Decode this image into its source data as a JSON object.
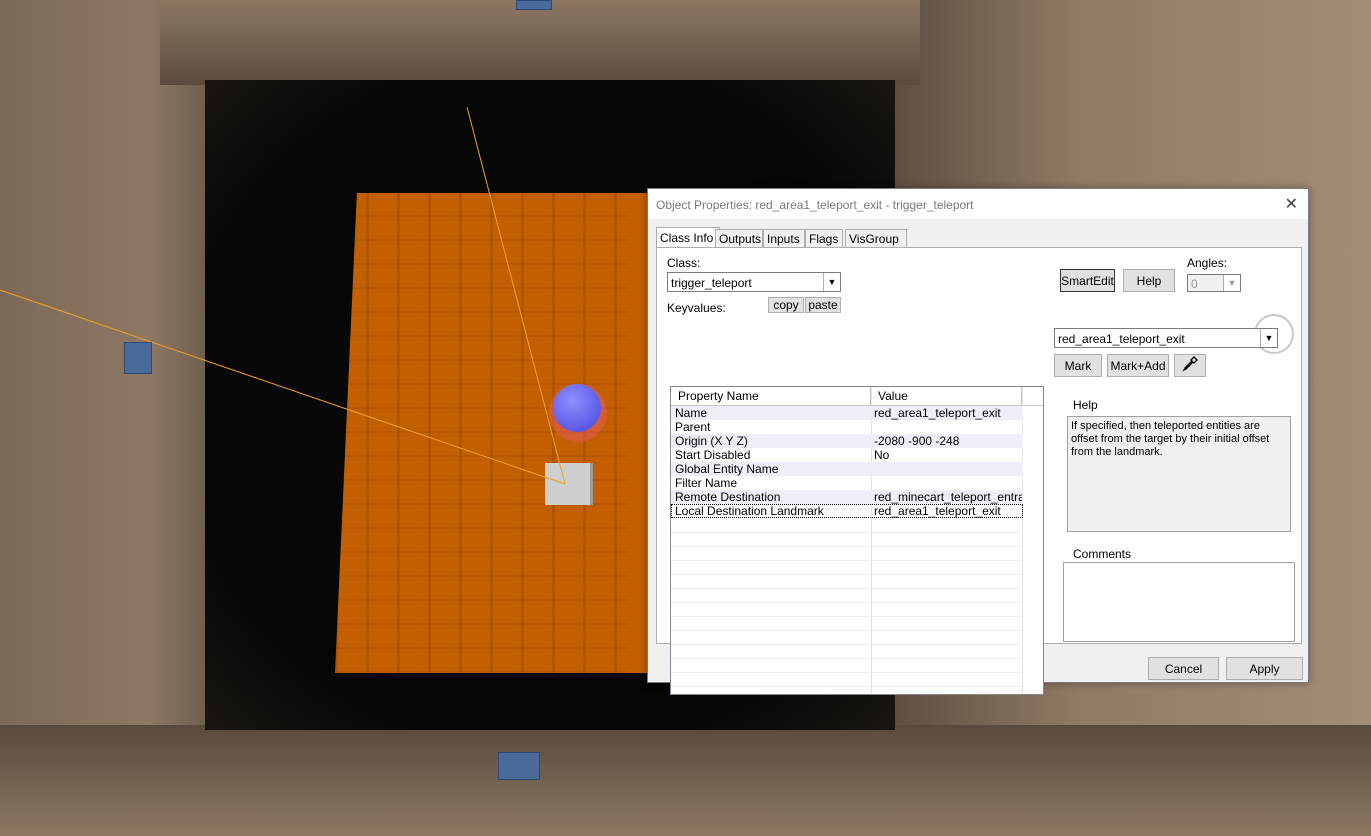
{
  "dialog": {
    "title": "Object Properties: red_area1_teleport_exit - trigger_teleport",
    "tabs": [
      "Class Info",
      "Outputs",
      "Inputs",
      "Flags",
      "VisGroup"
    ],
    "class_label": "Class:",
    "class_value": "trigger_teleport",
    "keyvalues_label": "Keyvalues:",
    "copy_label": "copy",
    "paste_label": "paste",
    "smartedit_label": "SmartEdit",
    "help_button_label": "Help",
    "angles_label": "Angles:",
    "angles_value": "0",
    "columns": [
      "Property Name",
      "Value"
    ],
    "rows": [
      {
        "name": "Name",
        "value": "red_area1_teleport_exit"
      },
      {
        "name": "Parent",
        "value": ""
      },
      {
        "name": "Origin (X Y Z)",
        "value": "-2080 -900 -248"
      },
      {
        "name": "Start Disabled",
        "value": "No"
      },
      {
        "name": "Global Entity Name",
        "value": ""
      },
      {
        "name": "Filter Name",
        "value": ""
      },
      {
        "name": "Remote Destination",
        "value": "red_minecart_teleport_entrance"
      },
      {
        "name": "Local Destination Landmark",
        "value": "red_area1_teleport_exit"
      }
    ],
    "selected_row": 7,
    "value_combo": "red_area1_teleport_exit",
    "mark_label": "Mark",
    "mark_add_label": "Mark+Add",
    "help_heading": "Help",
    "help_text": "If specified, then teleported entities are offset from the target by their initial offset from the landmark.",
    "comments_heading": "Comments",
    "cancel_label": "Cancel",
    "apply_label": "Apply"
  },
  "viewport": {
    "brush_color": "#c45f00",
    "sphere_color": "#6b6bf5",
    "line_color": "#f0a020"
  }
}
